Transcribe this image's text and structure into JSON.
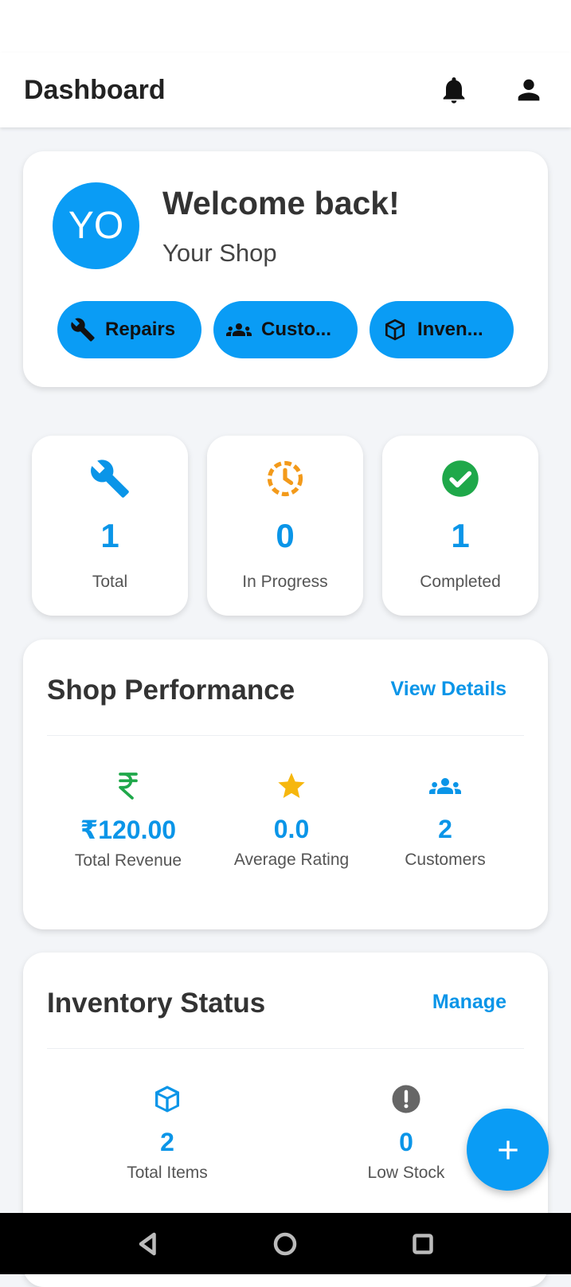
{
  "app_bar": {
    "title": "Dashboard",
    "icons": [
      "bell-icon",
      "account-icon"
    ]
  },
  "welcome": {
    "avatar_initials": "YO",
    "title": "Welcome back!",
    "subtitle": "Your Shop",
    "chips": [
      {
        "label": "Repairs",
        "icon": "wrench-icon"
      },
      {
        "label": "Custo...",
        "icon": "group-icon"
      },
      {
        "label": "Inven...",
        "icon": "box-icon"
      }
    ]
  },
  "stats": [
    {
      "value": "1",
      "label": "Total",
      "icon": "wrench-icon",
      "color": "#0a95e8"
    },
    {
      "value": "0",
      "label": "In Progress",
      "icon": "clock-icon",
      "color": "#f39a1a"
    },
    {
      "value": "1",
      "label": "Completed",
      "icon": "check-circle-icon",
      "color": "#1fa84a"
    }
  ],
  "performance": {
    "title": "Shop Performance",
    "link": "View Details",
    "metrics": [
      {
        "value": "₹120.00",
        "label": "Total Revenue",
        "icon": "rupee-icon",
        "color": "#1fa84a"
      },
      {
        "value": "0.0",
        "label": "Average Rating",
        "icon": "star-icon",
        "color": "#f6b70e"
      },
      {
        "value": "2",
        "label": "Customers",
        "icon": "group-icon",
        "color": "#0a95e8"
      }
    ]
  },
  "inventory": {
    "title": "Inventory Status",
    "link": "Manage",
    "metrics": [
      {
        "value": "2",
        "label": "Total Items",
        "icon": "box-icon",
        "color": "#0a95e8"
      },
      {
        "value": "0",
        "label": "Low Stock",
        "icon": "alert-circle-icon",
        "color": "#666666"
      }
    ]
  },
  "fab": {
    "icon": "plus-icon"
  },
  "accent_color": "#0a9cf5"
}
